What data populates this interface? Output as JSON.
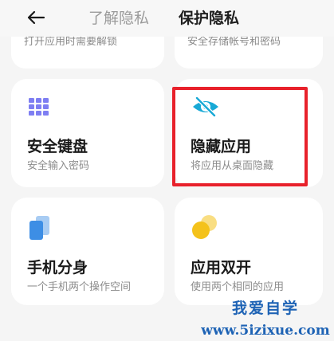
{
  "header": {
    "tabs": [
      {
        "label": "了解隐私",
        "active": false
      },
      {
        "label": "保护隐私",
        "active": true
      }
    ]
  },
  "top_cards_partial": [
    {
      "subtitle": "打开应用时需要解锁"
    },
    {
      "subtitle": "安全存储帐号和密码"
    }
  ],
  "cards": [
    {
      "title": "安全键盘",
      "subtitle": "安全输入密码",
      "icon": "keyboard-grid-icon"
    },
    {
      "title": "隐藏应用",
      "subtitle": "将应用从桌面隐藏",
      "icon": "eye-slash-icon"
    },
    {
      "title": "手机分身",
      "subtitle": "一个手机两个操作空间",
      "icon": "second-space-icon"
    },
    {
      "title": "应用双开",
      "subtitle": "使用两个相同的应用",
      "icon": "dual-apps-icon"
    }
  ],
  "colors": {
    "highlight": "#e8212b",
    "keyboard_icon": "#7e7ef2",
    "eye_icon": "#18a9d6",
    "space_icon": "#3d8ee5",
    "dual_icon": "#f4c21b",
    "watermark": "#1e63b5"
  },
  "watermark": {
    "line1": "我爱自学",
    "line2": "www.5izixue.com"
  }
}
